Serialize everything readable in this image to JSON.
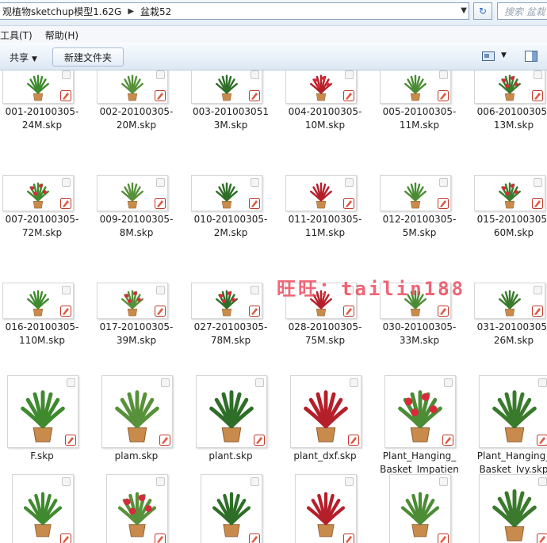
{
  "address": {
    "path_part1": "观植物sketchup模型1.62G",
    "path_part2": "盆栽52",
    "search_placeholder": "搜索 盆栽"
  },
  "menu": {
    "tools": "工具(T)",
    "help": "帮助(H)"
  },
  "toolbar": {
    "share": "共享",
    "new_folder": "新建文件夹"
  },
  "files": [
    {
      "name": "001-20100305-24M.skp"
    },
    {
      "name": "002-20100305-20M.skp"
    },
    {
      "name": "003-201003051 3M.skp"
    },
    {
      "name": "004-20100305-10M.skp"
    },
    {
      "name": "005-20100305-11M.skp"
    },
    {
      "name": "006-20100305-13M.skp"
    },
    {
      "name": "007-20100305-72M.skp"
    },
    {
      "name": "009-20100305-8M.skp"
    },
    {
      "name": "010-20100305-2M.skp"
    },
    {
      "name": "011-20100305-11M.skp"
    },
    {
      "name": "012-20100305-5M.skp"
    },
    {
      "name": "015-20100305-60M.skp"
    },
    {
      "name": "016-20100305-110M.skp"
    },
    {
      "name": "017-20100305-39M.skp"
    },
    {
      "name": "027-20100305-78M.skp"
    },
    {
      "name": "028-20100305-75M.skp"
    },
    {
      "name": "030-20100305-33M.skp"
    },
    {
      "name": "031-20100305-26M.skp"
    },
    {
      "name": "F.skp"
    },
    {
      "name": "plam.skp"
    },
    {
      "name": "plant.skp"
    },
    {
      "name": "plant_dxf.skp"
    },
    {
      "name": "Plant_Hanging_Basket_Impatiens.skp"
    },
    {
      "name": "Plant_Hanging_Basket_Ivy.skp"
    },
    {
      "name": ""
    },
    {
      "name": ""
    },
    {
      "name": ""
    },
    {
      "name": ""
    },
    {
      "name": ""
    },
    {
      "name": ""
    }
  ],
  "watermark": "旺旺：tailin188",
  "colors": {
    "watermark": "#ec4458",
    "accent": "#2a6bbf"
  }
}
